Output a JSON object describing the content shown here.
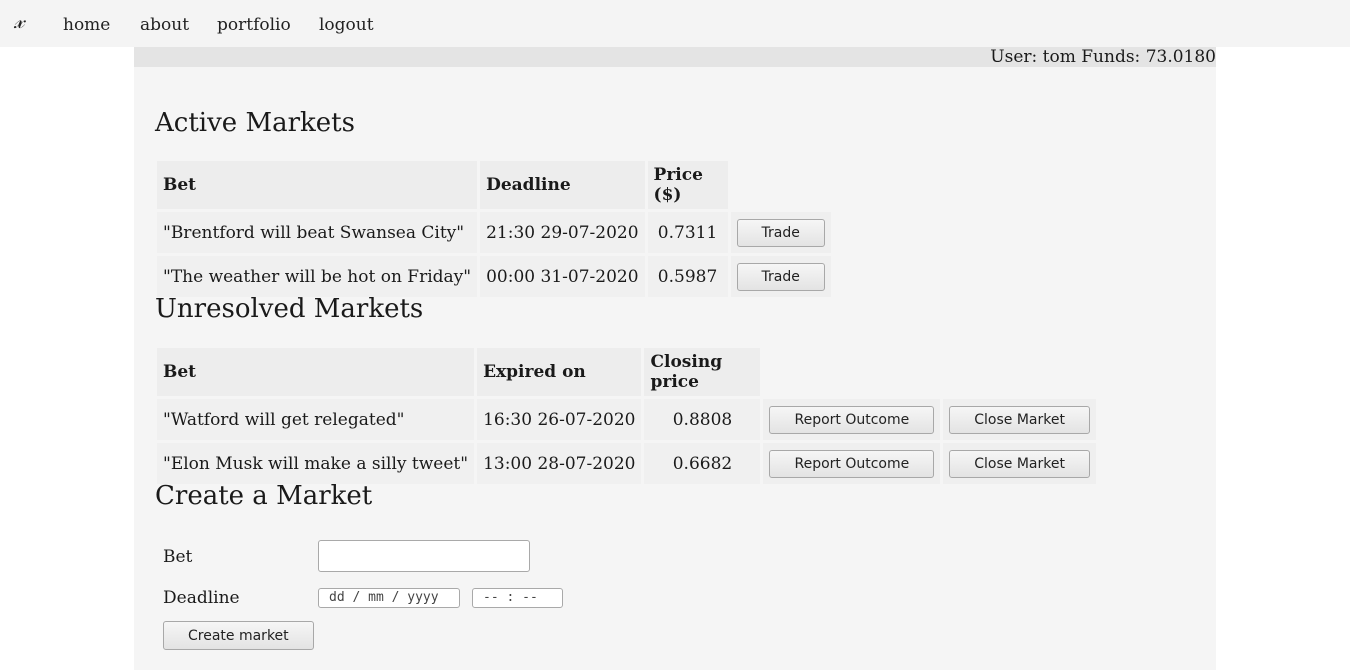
{
  "nav": {
    "logo": "𝓍",
    "items": [
      {
        "label": "home"
      },
      {
        "label": "about"
      },
      {
        "label": "portfolio"
      },
      {
        "label": "logout"
      }
    ]
  },
  "user_info": "User: tom Funds: 73.0180",
  "active": {
    "title": "Active Markets",
    "headers": [
      "Bet",
      "Deadline",
      "Price ($)"
    ],
    "rows": [
      {
        "bet": "\"Brentford will beat Swansea City\"",
        "deadline": "21:30 29-07-2020",
        "price": "0.7311",
        "action": "Trade"
      },
      {
        "bet": "\"The weather will be hot on Friday\"",
        "deadline": "00:00 31-07-2020",
        "price": "0.5987",
        "action": "Trade"
      }
    ]
  },
  "unresolved": {
    "title": "Unresolved Markets",
    "headers": [
      "Bet",
      "Expired on",
      "Closing price"
    ],
    "rows": [
      {
        "bet": "\"Watford will get relegated\"",
        "expired": "16:30 26-07-2020",
        "price": "0.8808",
        "report": "Report Outcome",
        "close": "Close Market"
      },
      {
        "bet": "\"Elon Musk will make a silly tweet\"",
        "expired": "13:00 28-07-2020",
        "price": "0.6682",
        "report": "Report Outcome",
        "close": "Close Market"
      }
    ]
  },
  "create": {
    "title": "Create a Market",
    "bet_label": "Bet",
    "bet_value": "",
    "deadline_label": "Deadline",
    "date_placeholder": "dd / mm / yyyy",
    "time_placeholder": "-- : --",
    "submit": "Create market"
  }
}
